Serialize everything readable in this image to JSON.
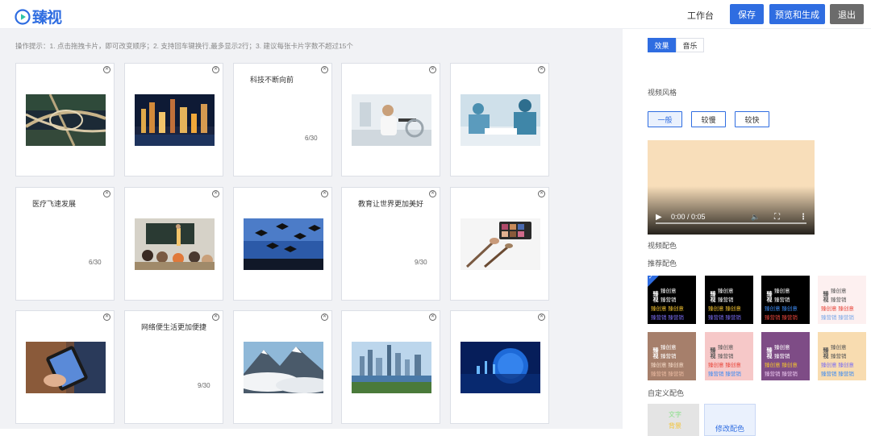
{
  "header": {
    "logo_text": "臻视",
    "workspace": "工作台",
    "save": "保存",
    "preview": "预览和生成",
    "exit": "退出",
    "brand_color": "#2f6de1"
  },
  "tips": "操作提示：1. 点击拖拽卡片，即可改变顺序；2. 支持回车键换行,最多显示2行；3. 建议每张卡片字数不超过15个",
  "cards": [
    {
      "kind": "image",
      "image": "highway-interchange-aerial"
    },
    {
      "kind": "image",
      "image": "city-night-skyline"
    },
    {
      "kind": "text",
      "text": "科技不断向前",
      "count": "6/30"
    },
    {
      "kind": "image",
      "image": "medical-lab-worker"
    },
    {
      "kind": "image",
      "image": "surgery-operating-room"
    },
    {
      "kind": "text",
      "text": "医疗飞速发展",
      "count": "6/30"
    },
    {
      "kind": "image",
      "image": "classroom-lecture"
    },
    {
      "kind": "image",
      "image": "graduation-caps-sky"
    },
    {
      "kind": "text",
      "text": "教育让世界更加美好",
      "count": "9/30"
    },
    {
      "kind": "image",
      "image": "makeup-palette-brushes"
    },
    {
      "kind": "image",
      "image": "smartphone-in-hand"
    },
    {
      "kind": "text",
      "text": "网络便生活更加便捷",
      "count": "9/30"
    },
    {
      "kind": "image",
      "image": "mountains-above-clouds"
    },
    {
      "kind": "image",
      "image": "city-waterfront-skyline"
    },
    {
      "kind": "image",
      "image": "blue-digital-globe"
    }
  ],
  "panel": {
    "tab_effect": "效果",
    "tab_music": "音乐",
    "video_style_label": "视频风格",
    "speeds": [
      "一般",
      "较慢",
      "较快"
    ],
    "selected_speed": "一般",
    "video_time": "0:00 / 0:05",
    "video_color_label": "视频配色",
    "recommended_label": "推荐配色",
    "custom_label": "自定义配色",
    "custom_text_label": "文字",
    "custom_bg_label": "背景",
    "custom_edit_label": "修改配色",
    "swatch_text": {
      "vertical": "臻视",
      "line1": "臻创意",
      "line2": "臻营销"
    },
    "swatches": [
      {
        "bg": "#000000",
        "c1": "#ffffff",
        "c2": "#f2c230",
        "c3": "#7a6cf2",
        "selected": true
      },
      {
        "bg": "#000000",
        "c1": "#ffffff",
        "c2": "#f2c230",
        "c3": "#7a6cf2",
        "selected": false
      },
      {
        "bg": "#000000",
        "c1": "#ffffff",
        "c2": "#3d8bf2",
        "c3": "#e8463b",
        "selected": false
      },
      {
        "bg": "#fdf0f0",
        "c1": "#555555",
        "c2": "#e8463b",
        "c3": "#7aa7e8",
        "selected": false
      },
      {
        "bg": "#a67f6b",
        "c1": "#ffffff",
        "c2": "#f4d9c6",
        "c3": "#e9b9a0",
        "selected": false
      },
      {
        "bg": "#f6c8c8",
        "c1": "#555555",
        "c2": "#e8463b",
        "c3": "#3d8bf2",
        "selected": false
      },
      {
        "bg": "#7e4c86",
        "c1": "#ffffff",
        "c2": "#f2c230",
        "c3": "#e8c3ec",
        "selected": false
      },
      {
        "bg": "#f8dcb0",
        "c1": "#555555",
        "c2": "#7a6cf2",
        "c3": "#3d8bf2",
        "selected": false
      }
    ]
  }
}
